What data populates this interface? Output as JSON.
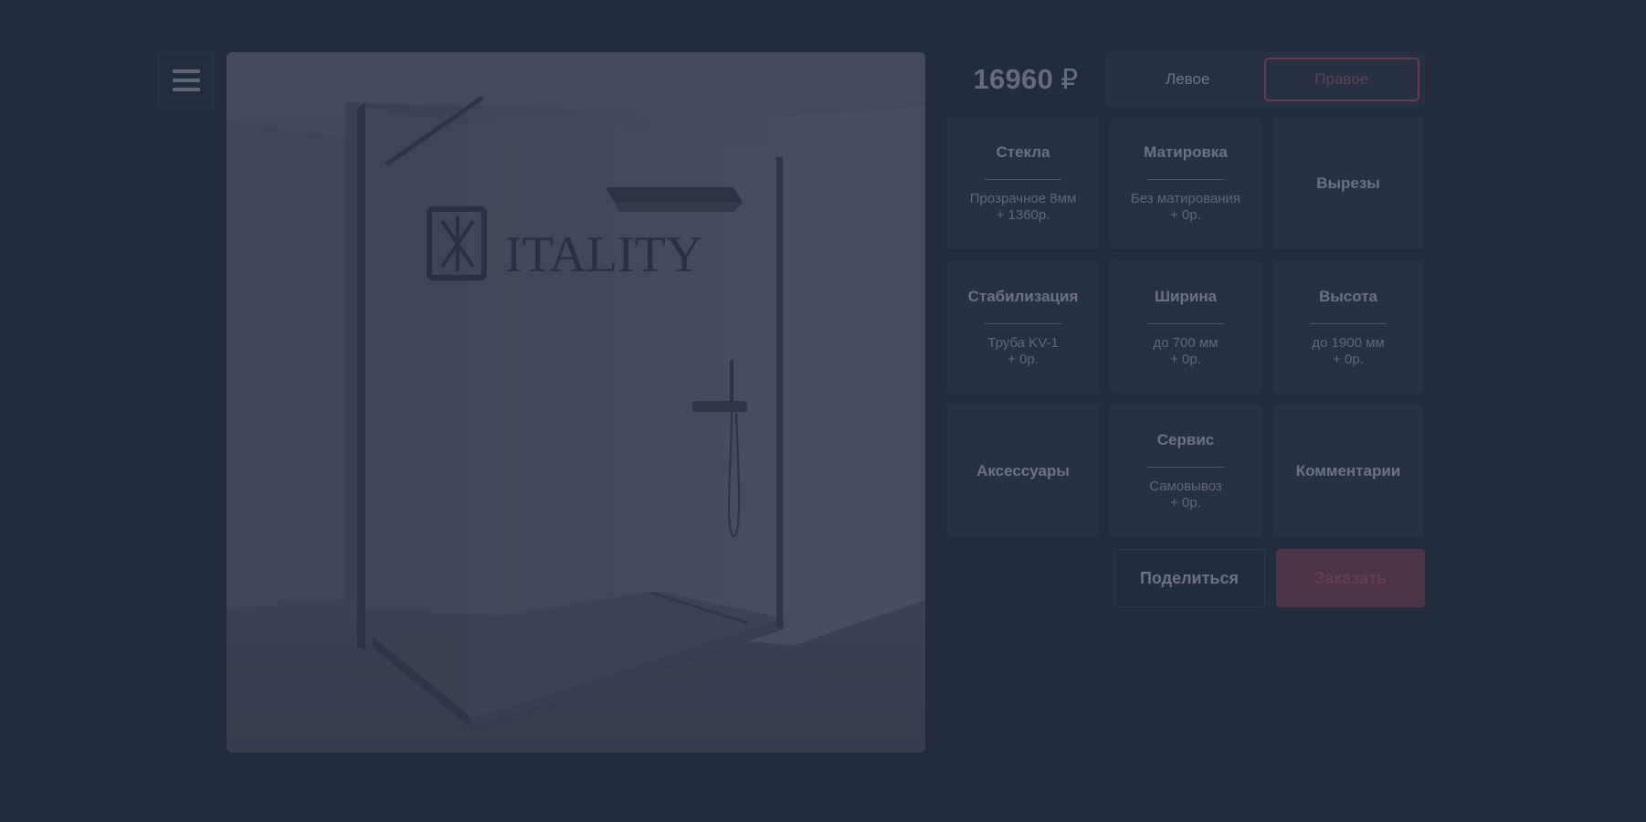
{
  "menu": {
    "icon": "hamburger-icon"
  },
  "preview": {
    "brand_logo_text": "ITALITY"
  },
  "price": {
    "amount": "16960",
    "currency": "₽"
  },
  "side_toggle": {
    "options": [
      {
        "label": "Левое",
        "active": false
      },
      {
        "label": "Правое",
        "active": true
      }
    ]
  },
  "options": [
    {
      "title": "Стекла",
      "value_line1": "Прозрачное 8мм",
      "value_line2": "+ 1360р."
    },
    {
      "title": "Матировка",
      "value_line1": "Без матирования",
      "value_line2": "+ 0р."
    },
    {
      "title": "Вырезы"
    },
    {
      "title": "Стабилизация",
      "value_line1": "Труба KV-1",
      "value_line2": "+ 0р."
    },
    {
      "title": "Ширина",
      "value_line1": "до 700 мм",
      "value_line2": "+ 0р."
    },
    {
      "title": "Высота",
      "value_line1": "до 1900 мм",
      "value_line2": "+ 0р."
    },
    {
      "title": "Аксессуары"
    },
    {
      "title": "Сервис",
      "value_line1": "Самовывоз",
      "value_line2": "+ 0р."
    },
    {
      "title": "Комментарии"
    }
  ],
  "actions": {
    "share_label": "Поделиться",
    "order_label": "Заказать"
  },
  "colors": {
    "background": "#232b3f",
    "tile": "#283045",
    "accent": "#6a3b4c",
    "order_button": "#4e3447"
  }
}
